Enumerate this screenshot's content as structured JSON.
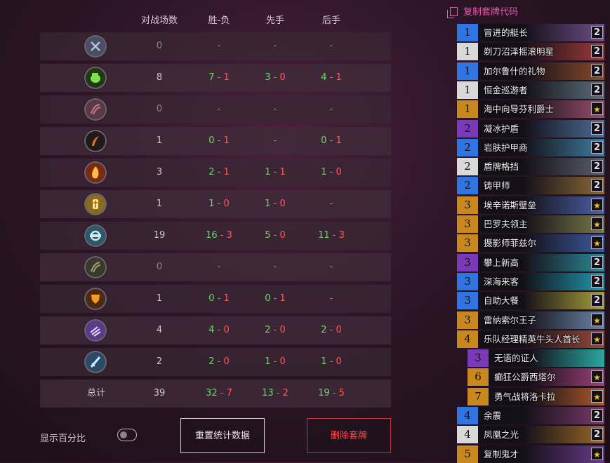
{
  "stats": {
    "headers": [
      "对战场数",
      "胜-负",
      "先手",
      "后手"
    ],
    "rows": [
      {
        "icon": "crossed-swords-icon",
        "games": "0",
        "record": {
          "w": "",
          "l": ""
        },
        "first": {
          "w": "",
          "l": ""
        },
        "second": {
          "w": "",
          "l": ""
        }
      },
      {
        "icon": "green-fist-icon",
        "games": "8",
        "record": {
          "w": "7",
          "l": "1"
        },
        "first": {
          "w": "3",
          "l": "0"
        },
        "second": {
          "w": "4",
          "l": "1"
        }
      },
      {
        "icon": "dragon-claw-icon",
        "games": "0",
        "record": {
          "w": "",
          "l": ""
        },
        "first": {
          "w": "",
          "l": ""
        },
        "second": {
          "w": "",
          "l": ""
        }
      },
      {
        "icon": "dagger-icon",
        "games": "1",
        "record": {
          "w": "0",
          "l": "1"
        },
        "first": {
          "w": "",
          "l": ""
        },
        "second": {
          "w": "0",
          "l": "1"
        }
      },
      {
        "icon": "fire-icon",
        "games": "3",
        "record": {
          "w": "2",
          "l": "1"
        },
        "first": {
          "w": "1",
          "l": "1"
        },
        "second": {
          "w": "1",
          "l": "0"
        }
      },
      {
        "icon": "holy-light-icon",
        "games": "1",
        "record": {
          "w": "1",
          "l": "0"
        },
        "first": {
          "w": "1",
          "l": "0"
        },
        "second": {
          "w": "",
          "l": ""
        }
      },
      {
        "icon": "gear-cannon-icon",
        "games": "19",
        "record": {
          "w": "16",
          "l": "3"
        },
        "first": {
          "w": "5",
          "l": "0"
        },
        "second": {
          "w": "11",
          "l": "3"
        }
      },
      {
        "icon": "nature-claw-icon",
        "games": "0",
        "record": {
          "w": "",
          "l": ""
        },
        "first": {
          "w": "",
          "l": ""
        },
        "second": {
          "w": "",
          "l": ""
        }
      },
      {
        "icon": "shield-crest-icon",
        "games": "1",
        "record": {
          "w": "0",
          "l": "1"
        },
        "first": {
          "w": "0",
          "l": "1"
        },
        "second": {
          "w": "",
          "l": ""
        }
      },
      {
        "icon": "arcane-hand-icon",
        "games": "4",
        "record": {
          "w": "4",
          "l": "0"
        },
        "first": {
          "w": "2",
          "l": "0"
        },
        "second": {
          "w": "2",
          "l": "0"
        }
      },
      {
        "icon": "sword-icon",
        "games": "2",
        "record": {
          "w": "2",
          "l": "0"
        },
        "first": {
          "w": "1",
          "l": "0"
        },
        "second": {
          "w": "1",
          "l": "0"
        }
      }
    ],
    "total": {
      "label": "总计",
      "games": "39",
      "record": {
        "w": "32",
        "l": "7"
      },
      "first": {
        "w": "13",
        "l": "2"
      },
      "second": {
        "w": "19",
        "l": "5"
      }
    },
    "dash": "-"
  },
  "controls": {
    "show_percent_label": "显示百分比",
    "show_percent_on": false,
    "reset_label": "重置统计数据",
    "delete_label": "删除套牌"
  },
  "deck": {
    "copy_label": "复制套牌代码",
    "cards": [
      {
        "cost": "1",
        "name": "冒进的艇长",
        "count": "2",
        "rarity": "rare",
        "art": "#6d4f88"
      },
      {
        "cost": "1",
        "name": "剃刀沼泽摇滚明星",
        "count": "2",
        "rarity": "common",
        "art": "#a03a3a"
      },
      {
        "cost": "1",
        "name": "加尔鲁什的礼物",
        "count": "2",
        "rarity": "rare",
        "art": "#8a4b2a"
      },
      {
        "cost": "1",
        "name": "恒金巡游者",
        "count": "2",
        "rarity": "common",
        "art": "#5b6f7a"
      },
      {
        "cost": "1",
        "name": "海中向导芬利爵士",
        "count": "★",
        "rarity": "legendary",
        "art": "#9a4f6a"
      },
      {
        "cost": "2",
        "name": "凝冰护盾",
        "count": "2",
        "rarity": "epic",
        "art": "#4b6d9a"
      },
      {
        "cost": "2",
        "name": "岩肤护甲商",
        "count": "2",
        "rarity": "rare",
        "art": "#3f7fa0"
      },
      {
        "cost": "2",
        "name": "盾牌格挡",
        "count": "2",
        "rarity": "common",
        "art": "#5a5f6a"
      },
      {
        "cost": "2",
        "name": "铸甲师",
        "count": "2",
        "rarity": "rare",
        "art": "#8a6a3a"
      },
      {
        "cost": "3",
        "name": "埃辛诺斯壁垒",
        "count": "★",
        "rarity": "legendary",
        "art": "#4a62a8"
      },
      {
        "cost": "3",
        "name": "巴罗夫领主",
        "count": "★",
        "rarity": "legendary",
        "art": "#7a7a4a"
      },
      {
        "cost": "3",
        "name": "摄影师菲兹尔",
        "count": "★",
        "rarity": "legendary",
        "art": "#3c5aa0"
      },
      {
        "cost": "3",
        "name": "攀上新高",
        "count": "2",
        "rarity": "epic",
        "art": "#2e8a9a"
      },
      {
        "cost": "3",
        "name": "深海来客",
        "count": "2",
        "rarity": "rare",
        "art": "#1f9ab0"
      },
      {
        "cost": "3",
        "name": "自助大餐",
        "count": "2",
        "rarity": "rare",
        "art": "#a8a03a"
      },
      {
        "cost": "3",
        "name": "雷纳索尔王子",
        "count": "★",
        "rarity": "legendary",
        "art": "#6a86a8"
      },
      {
        "cost": "4",
        "name": "乐队经理精英牛头人酋长",
        "count": "★",
        "rarity": "legendary",
        "art": "#9a4a3a"
      },
      {
        "cost": "3",
        "name": "无语的证人",
        "count": "",
        "rarity": "epic",
        "art": "#2aa8a0",
        "sub": true
      },
      {
        "cost": "6",
        "name": "癫狂公爵西塔尔",
        "count": "★",
        "rarity": "legendary",
        "art": "#a0407a",
        "sub": true
      },
      {
        "cost": "7",
        "name": "勇气战将洛卡拉",
        "count": "★",
        "rarity": "legendary",
        "art": "#b05a2a",
        "sub": true
      },
      {
        "cost": "4",
        "name": "余震",
        "count": "2",
        "rarity": "rare",
        "art": "#7a3a6a"
      },
      {
        "cost": "4",
        "name": "凤凰之光",
        "count": "2",
        "rarity": "common",
        "art": "#9a6a2a"
      },
      {
        "cost": "5",
        "name": "复制鬼才",
        "count": "★",
        "rarity": "legendary",
        "art": "#6a3a8a"
      }
    ]
  },
  "colors": {
    "win": "#5fe05f",
    "loss": "#ff5a5a",
    "accent": "#e45ab0"
  }
}
